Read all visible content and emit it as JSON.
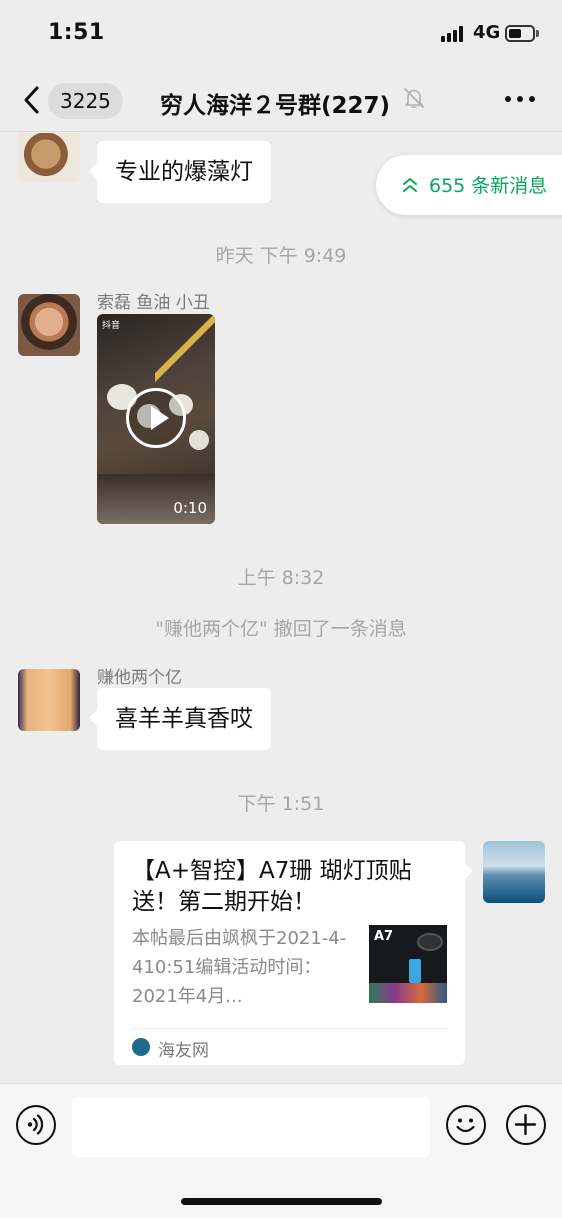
{
  "status_bar": {
    "time": "1:51",
    "network": "4G",
    "battery_level": 0.55
  },
  "nav": {
    "unread_count": "3225",
    "title": "穷人海洋２号群(227)",
    "muted": true
  },
  "chat": {
    "new_messages_label": "655 条新消息",
    "messages": [
      {
        "type": "text",
        "text": "专业的爆藻灯"
      },
      {
        "type": "time",
        "text": "昨天 下午 9:49"
      },
      {
        "type": "video",
        "sender": "索磊 鱼油 小丑",
        "duration": "0:10",
        "app_label": "抖音"
      },
      {
        "type": "time",
        "text": "上午 8:32"
      },
      {
        "type": "system",
        "text": "\"赚他两个亿\" 撤回了一条消息"
      },
      {
        "type": "text",
        "sender": "赚他两个亿",
        "text": "喜羊羊真香哎"
      },
      {
        "type": "time",
        "text": "下午 1:51"
      },
      {
        "type": "link_card",
        "title": "【A+智控】A7珊 瑚灯顶贴送！第二期开始！",
        "description": "本帖最后由飒枫于2021-4-410:51编辑活动时间：2021年4月...",
        "thumb_label": "A7",
        "source": "海友网"
      }
    ]
  },
  "input_bar": {
    "placeholder": ""
  },
  "icons": {
    "back": "chevron-left-icon",
    "mute": "bell-slash-icon",
    "more": "ellipsis-icon",
    "voice": "voice-icon",
    "emoji": "smiley-icon",
    "plus": "plus-icon",
    "new_messages": "double-chevron-up-icon"
  },
  "colors": {
    "accent_green": "#07a85b",
    "background": "#ededed"
  }
}
